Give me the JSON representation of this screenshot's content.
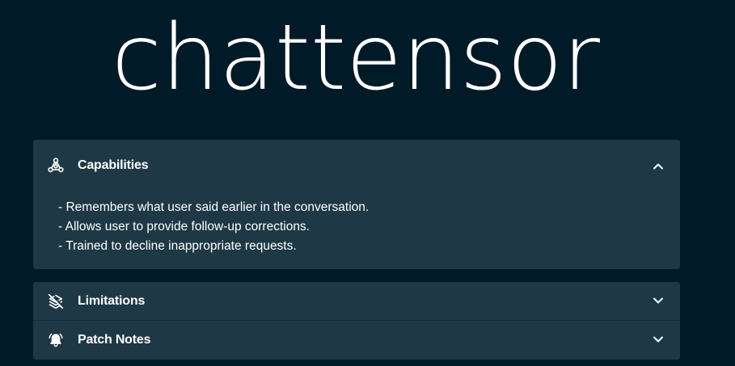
{
  "logo": {
    "text": "chattensor"
  },
  "sections": [
    {
      "title": "Capabilities",
      "icon": "nodes-icon",
      "expanded": true,
      "items": [
        "- Remembers what user said earlier in the conversation.",
        "- Allows user to provide follow-up corrections.",
        "- Trained to decline inappropriate requests."
      ]
    },
    {
      "title": "Limitations",
      "icon": "layers-off-icon",
      "expanded": false
    },
    {
      "title": "Patch Notes",
      "icon": "bell-ringing-icon",
      "expanded": false
    }
  ],
  "colors": {
    "background": "#011a27",
    "panel": "#1e3845",
    "text": "#ffffff"
  }
}
